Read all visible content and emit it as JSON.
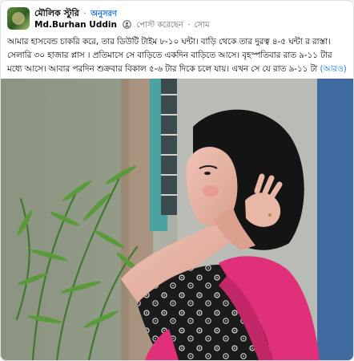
{
  "post": {
    "group_name": "মৌলিক স্টুরি",
    "separator": "·",
    "follow_label": "অনুসরণ",
    "author": "Md.Burhan Uddin",
    "posted_text": "পোস্ট করেছেন",
    "time": "সোম",
    "body": "আমার হাসবেন্ড চাকরি করে, তার ডিউটি টাইম ৮-১০ ঘন্টা। বাড়ি থেকে তার দুরত্ব ৪-৫ ঘন্টা র রাস্তা। সেলারি ৩০ হাজার প্লাস । প্রতিমাসে সে বাড়িতে একদিন বাড়িতে আসে। বৃহস্পতিবার রাত ৯-১১ টার মধ্যে আসে। আবার পরদিন শুক্রবার বিকাল ৫-৬ টার দিকে চলে যায়। এখন সে যে রাত ৯-১১ টা",
    "see_more": "(আরও)"
  },
  "icons": {
    "avatar": "group-avatar-icon",
    "badge": "group-member-badge-icon"
  },
  "colors": {
    "link": "#1b74e4",
    "text": "#050505",
    "secondary": "#65676b",
    "saree_pink": "#e0307a",
    "dress_black": "#1b1b1b"
  }
}
